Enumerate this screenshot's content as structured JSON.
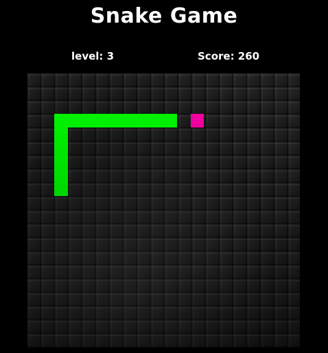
{
  "header": {
    "title": "Snake Game"
  },
  "hud": {
    "level_text": "level: 3",
    "score_text": "Score: 260"
  },
  "game": {
    "level": 3,
    "score": 260
  },
  "colors": {
    "background": "#000000",
    "snake": "#00ff00",
    "food": "#ff00aa",
    "text": "#ffffff"
  }
}
